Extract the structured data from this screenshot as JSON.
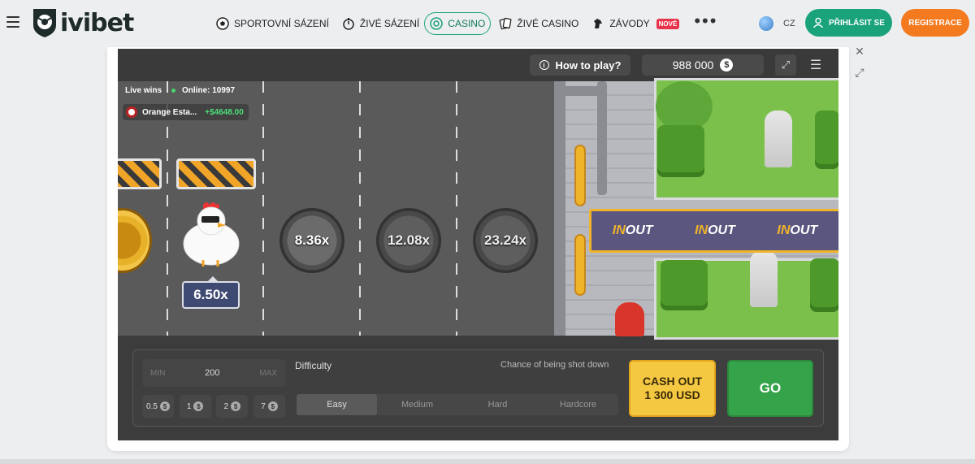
{
  "header": {
    "logo_text": "ivibet",
    "nav": [
      {
        "label": "SPORTOVNÍ SÁZENÍ",
        "icon": "soccer-ball-icon"
      },
      {
        "label": "ŽIVÉ SÁZENÍ",
        "icon": "stopwatch-icon"
      },
      {
        "label": "CASINO",
        "icon": "casino-chip-icon",
        "active": true
      },
      {
        "label": "ŽIVÉ CASINO",
        "icon": "cards-icon"
      },
      {
        "label": "ZÁVODY",
        "icon": "horse-icon",
        "badge": "NOVÉ"
      }
    ],
    "more": "•••",
    "language": "CZ",
    "login_label": "PŘIHLÁSIT SE",
    "register_label": "REGISTRACE",
    "colors": {
      "accent": "#1aa37b",
      "register": "#f47a1f",
      "badge": "#e8334a"
    }
  },
  "game": {
    "how_to_play": "How to play?",
    "balance": "988 000",
    "currency_icon": "$",
    "live": {
      "label": "Live wins",
      "online": "Online: 10997"
    },
    "last_win": {
      "name": "Orange Esta...",
      "amount": "+$4648.00"
    },
    "current_multiplier": "6.50x",
    "multipliers": [
      "8.36x",
      "12.08x",
      "23.24x"
    ],
    "banner_text": [
      "IN",
      "OUT"
    ],
    "controls": {
      "min_label": "MIN",
      "bet_value": "200",
      "max_label": "MAX",
      "chips": [
        "0.5",
        "1",
        "2",
        "7"
      ],
      "difficulty_label": "Difficulty",
      "chance_label": "Chance of being shot down",
      "difficulties": [
        "Easy",
        "Medium",
        "Hard",
        "Hardcore"
      ],
      "active_difficulty": "Easy",
      "cashout_line1": "CASH OUT",
      "cashout_line2": "1 300 USD",
      "go_label": "GO"
    }
  }
}
